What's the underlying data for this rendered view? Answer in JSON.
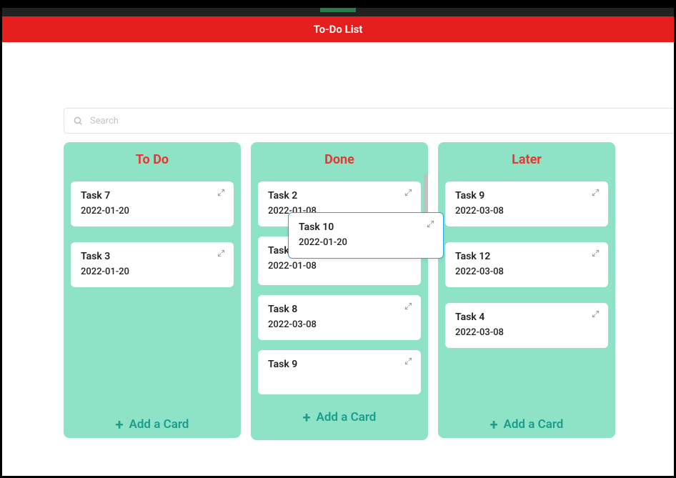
{
  "header": {
    "title": "To-Do List"
  },
  "search": {
    "placeholder": "Search"
  },
  "columns": {
    "todo": {
      "title": "To Do",
      "add_label": "Add a Card",
      "cards": [
        {
          "title": "Task 7",
          "date": "2022-01-20"
        },
        {
          "title": "Task 3",
          "date": "2022-01-20"
        }
      ]
    },
    "done": {
      "title": "Done",
      "add_label": "Add a Card",
      "cards": [
        {
          "title": "Task 2",
          "date": "2022-01-08"
        },
        {
          "title": "Task 6",
          "date": "2022-01-08"
        },
        {
          "title": "Task 8",
          "date": "2022-03-08"
        },
        {
          "title": "Task 9",
          "date": ""
        }
      ]
    },
    "later": {
      "title": "Later",
      "add_label": "Add a Card",
      "cards": [
        {
          "title": "Task 9",
          "date": "2022-03-08"
        },
        {
          "title": "Task 12",
          "date": "2022-03-08"
        },
        {
          "title": "Task 4",
          "date": "2022-03-08"
        }
      ]
    }
  },
  "dragging_card": {
    "title": "Task 10",
    "date": "2022-01-20"
  }
}
